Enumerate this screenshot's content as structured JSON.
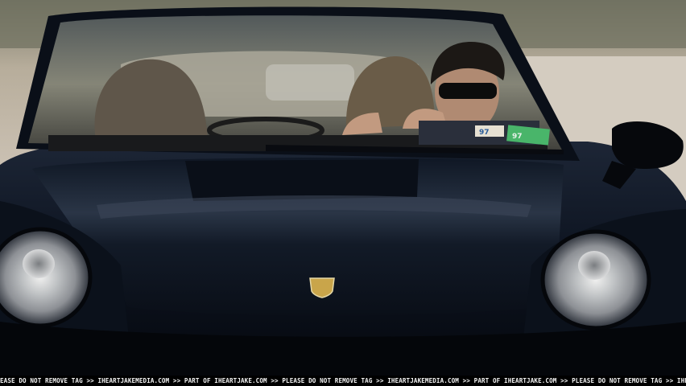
{
  "frame": {
    "watermark_tag": "EASE DO NOT REMOVE TAG >> IHEARTJAKEMEDIA.COM >> PART OF IHEARTJAKE.COM >> PLEASE DO NOT REMOVE TAG >> IHEARTJAKEMEDIA.COM >> PART OF IHEARTJAKE.COM >> PLEASE DO NOT REMOVE TAG >> IHEARTJAKE"
  },
  "scene": {
    "subject": "black sports car, front view, driver in sunglasses",
    "plate_sticker_a": "97",
    "plate_sticker_b": "97",
    "colors": {
      "car_body": "#0d1420",
      "background_road": "#c9bfb3",
      "headlight": "#cfcfcf",
      "sticker_green": "#49b56a"
    }
  }
}
